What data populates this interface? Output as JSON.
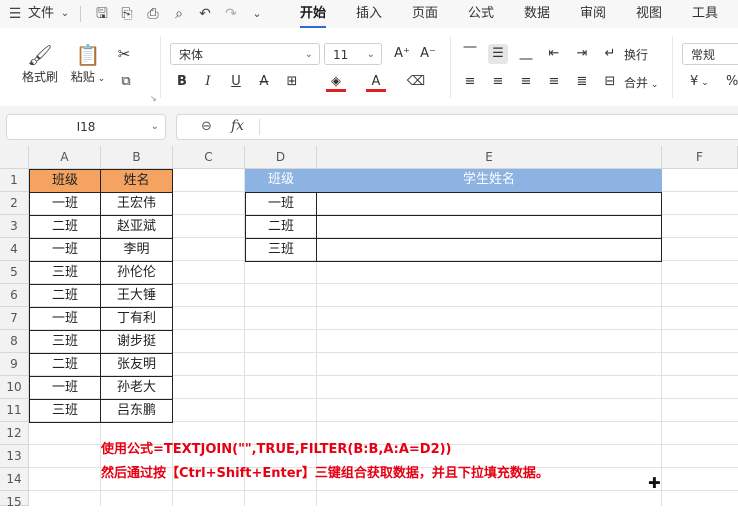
{
  "topbar": {
    "file_label": "文件",
    "tabs": [
      {
        "label": "开始",
        "active": true
      },
      {
        "label": "插入"
      },
      {
        "label": "页面"
      },
      {
        "label": "公式"
      },
      {
        "label": "数据"
      },
      {
        "label": "审阅"
      },
      {
        "label": "视图"
      },
      {
        "label": "工具"
      }
    ]
  },
  "ribbon": {
    "format_painter": "格式刷",
    "paste": "粘贴",
    "font_name": "宋体",
    "font_size": "11",
    "wrap": "换行",
    "merge": "合并",
    "number_format": "常规",
    "currency_symbol": "¥"
  },
  "formula_bar": {
    "cell_ref": "I18",
    "fx_label": "fx",
    "formula": ""
  },
  "columns": [
    "A",
    "B",
    "C",
    "D",
    "E",
    "F"
  ],
  "rows": [
    "1",
    "2",
    "3",
    "4",
    "5",
    "6",
    "7",
    "8",
    "9",
    "10",
    "11",
    "12",
    "13",
    "14",
    "15"
  ],
  "table1": {
    "headers": [
      "班级",
      "姓名"
    ],
    "rows": [
      [
        "一班",
        "王宏伟"
      ],
      [
        "二班",
        "赵亚斌"
      ],
      [
        "一班",
        "李明"
      ],
      [
        "三班",
        "孙伦伦"
      ],
      [
        "二班",
        "王大锤"
      ],
      [
        "一班",
        "丁有利"
      ],
      [
        "三班",
        "谢步挺"
      ],
      [
        "二班",
        "张友明"
      ],
      [
        "一班",
        "孙老大"
      ],
      [
        "三班",
        "吕东鹏"
      ]
    ]
  },
  "table2": {
    "headers": [
      "班级",
      "学生姓名"
    ],
    "rows": [
      [
        "一班",
        ""
      ],
      [
        "二班",
        ""
      ],
      [
        "三班",
        ""
      ]
    ]
  },
  "note": {
    "line1": "使用公式=TEXTJOIN(\"\",TRUE,FILTER(B:B,A:A=D2))",
    "line2": "然后通过按【Ctrl+Shift+Enter】三键组合获取数据，并且下拉填充数据。"
  },
  "colors": {
    "header_orange": "#f4a460",
    "header_blue": "#8db3e2",
    "note_red": "#e60012",
    "active_tab": "#2e6bd6"
  }
}
